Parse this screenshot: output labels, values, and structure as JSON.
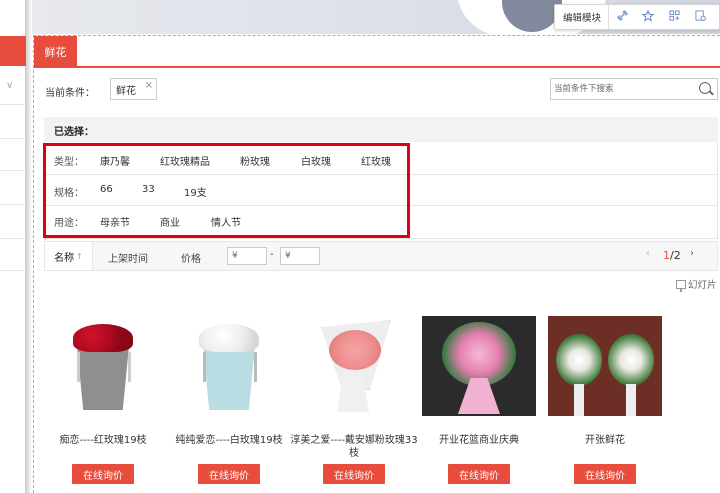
{
  "toolbar": {
    "edit_label": "编辑模块",
    "icons": [
      "link-icon",
      "star-icon",
      "grid-icon",
      "settings-icon"
    ]
  },
  "tab": {
    "label": "鲜花"
  },
  "conditions": {
    "label": "当前条件：",
    "tag": "鲜花",
    "search_placeholder": "当前条件下搜索"
  },
  "filter": {
    "selected_label": "已选择：",
    "rows": [
      {
        "label": "类型：",
        "options": [
          "康乃馨",
          "红玫瑰精品",
          "粉玫瑰",
          "白玫瑰",
          "红玫瑰"
        ]
      },
      {
        "label": "规格：",
        "options": [
          "66",
          "33",
          "19支"
        ]
      },
      {
        "label": "用途：",
        "options": [
          "母亲节",
          "商业",
          "情人节"
        ]
      }
    ]
  },
  "sort": {
    "name_label": "名称",
    "time_label": "上架时间",
    "price_label": "价格",
    "price_min": "¥",
    "price_max": "¥",
    "dash": "-",
    "page_current": "1",
    "page_total": "/2"
  },
  "slide_label": "幻灯片",
  "products": [
    {
      "name": "痴恋----红玫瑰19枝",
      "ask": "在线询价"
    },
    {
      "name": "纯纯爱恋----白玫瑰19枝",
      "ask": "在线询价"
    },
    {
      "name": "淳美之爱----戴安娜粉玫瑰33枝",
      "ask": "在线询价"
    },
    {
      "name": "开业花篮商业庆典",
      "ask": "在线询价"
    },
    {
      "name": "开张鲜花",
      "ask": "在线询价"
    }
  ],
  "colors": {
    "accent": "#e84c3d",
    "highlight": "#e0000f"
  }
}
